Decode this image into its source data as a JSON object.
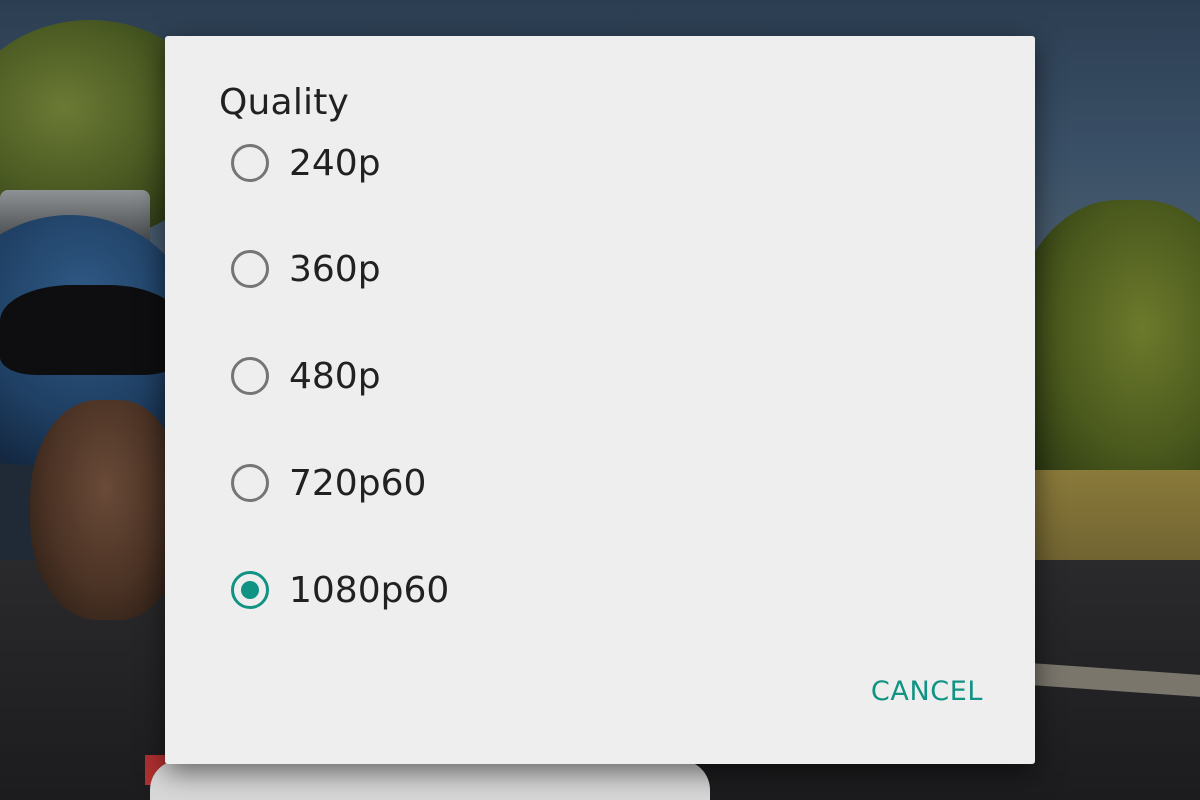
{
  "dialog": {
    "title": "Quality",
    "options": [
      {
        "label": "240p",
        "selected": false
      },
      {
        "label": "360p",
        "selected": false
      },
      {
        "label": "480p",
        "selected": false
      },
      {
        "label": "720p60",
        "selected": false
      },
      {
        "label": "1080p60",
        "selected": true
      }
    ],
    "cancel_label": "CANCEL"
  },
  "colors": {
    "accent": "#119383",
    "dialog_background": "#eeeeee",
    "text": "#212121",
    "radio_unchecked": "#757575"
  }
}
